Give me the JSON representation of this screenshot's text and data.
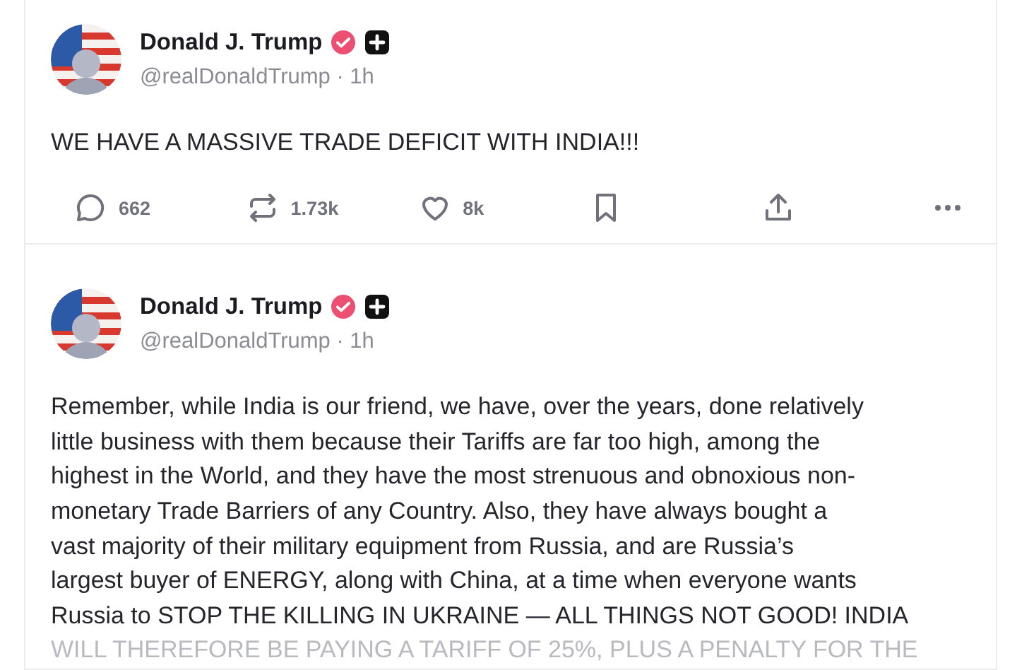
{
  "posts": [
    {
      "author": {
        "name": "Donald J. Trump",
        "handle": "@realDonaldTrump",
        "time": "· 1h",
        "verified": true,
        "plus": true
      },
      "lines": [
        "WE HAVE A MASSIVE TRADE DEFICIT WITH INDIA!!!"
      ],
      "actions": [
        {
          "kind": "reply",
          "count": "662"
        },
        {
          "kind": "repost",
          "count": "1.73k"
        },
        {
          "kind": "like",
          "count": "8k"
        },
        {
          "kind": "bookmark"
        },
        {
          "kind": "share"
        },
        {
          "kind": "more"
        }
      ]
    },
    {
      "author": {
        "name": "Donald J. Trump",
        "handle": "@realDonaldTrump",
        "time": "· 1h",
        "verified": true,
        "plus": true
      },
      "lines": [
        "Remember, while India is our friend, we have, over the years, done relatively",
        "little business with them because their Tariffs are far too high, among the",
        "highest in the World, and they have the most strenuous and obnoxious non-",
        "monetary Trade Barriers of any Country. Also, they have always bought a",
        "vast majority of their military equipment from Russia, and are Russia’s",
        "largest buyer of ENERGY, along with China, at a time when everyone wants",
        "Russia to STOP THE KILLING IN UKRAINE — ALL THINGS NOT GOOD! INDIA",
        "WILL THEREFORE BE PAYING A TARIFF OF 25%, PLUS A PENALTY FOR THE"
      ]
    }
  ]
}
